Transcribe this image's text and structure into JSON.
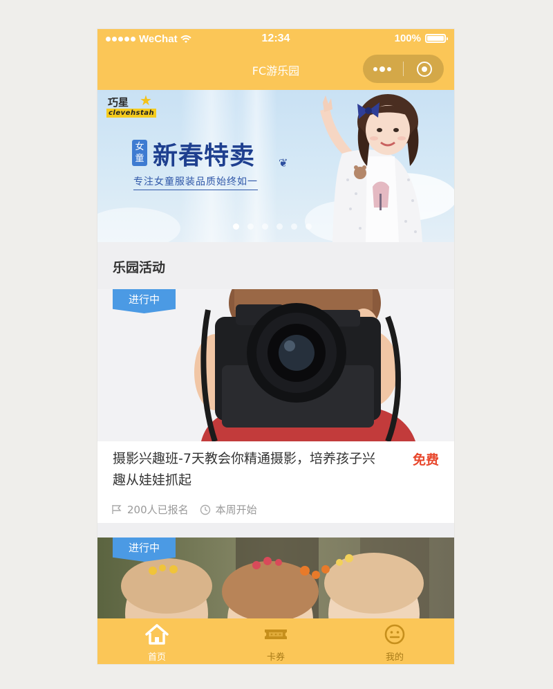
{
  "status_bar": {
    "carrier": "WeChat",
    "time": "12:34",
    "battery": "100%"
  },
  "nav": {
    "title": "FC游乐园"
  },
  "banner": {
    "brand_cn": "巧星",
    "brand_en": "clevehstah",
    "badge": "女童",
    "headline": "新春特卖",
    "subtitle": "专注女童服装品质始终如一",
    "slides": 6,
    "active_slide": 0
  },
  "section": {
    "title": "乐园活动"
  },
  "cards": [
    {
      "status": "进行中",
      "title": "摄影兴趣班-7天教会你精通摄影，培养孩子兴趣从娃娃抓起",
      "price": "免费",
      "signups": "200人已报名",
      "start": "本周开始"
    },
    {
      "status": "进行中"
    }
  ],
  "tabbar": {
    "items": [
      {
        "label": "首页",
        "icon": "home-icon",
        "active": true
      },
      {
        "label": "卡券",
        "icon": "ticket-icon",
        "active": false
      },
      {
        "label": "我的",
        "icon": "smiley-icon",
        "active": false
      }
    ]
  },
  "colors": {
    "brand": "#fbc657",
    "ribbon": "#4b9ae4",
    "price": "#e8472c"
  }
}
